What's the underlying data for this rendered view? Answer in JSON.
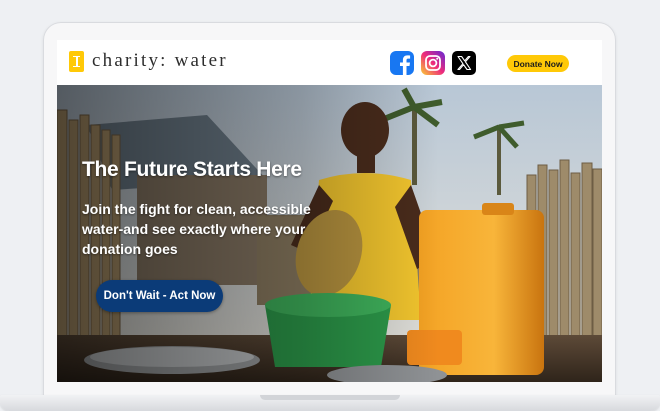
{
  "brand": {
    "name": "charity: water",
    "logo_icon": "jerrycan-icon",
    "accent_color": "#ffc907"
  },
  "header": {
    "social": [
      {
        "name": "facebook",
        "icon": "facebook-icon",
        "color": "#1877f2"
      },
      {
        "name": "instagram",
        "icon": "instagram-icon",
        "color": "#e1306c"
      },
      {
        "name": "x",
        "icon": "x-icon",
        "color": "#000000"
      }
    ],
    "donate_label": "Donate Now"
  },
  "hero": {
    "title": "The Future Starts Here",
    "subtitle": "Join the fight for clean, accessible water-and see exactly where your donation goes",
    "cta_label": "Don't Wait - Act Now",
    "cta_color": "#0b3b78"
  }
}
